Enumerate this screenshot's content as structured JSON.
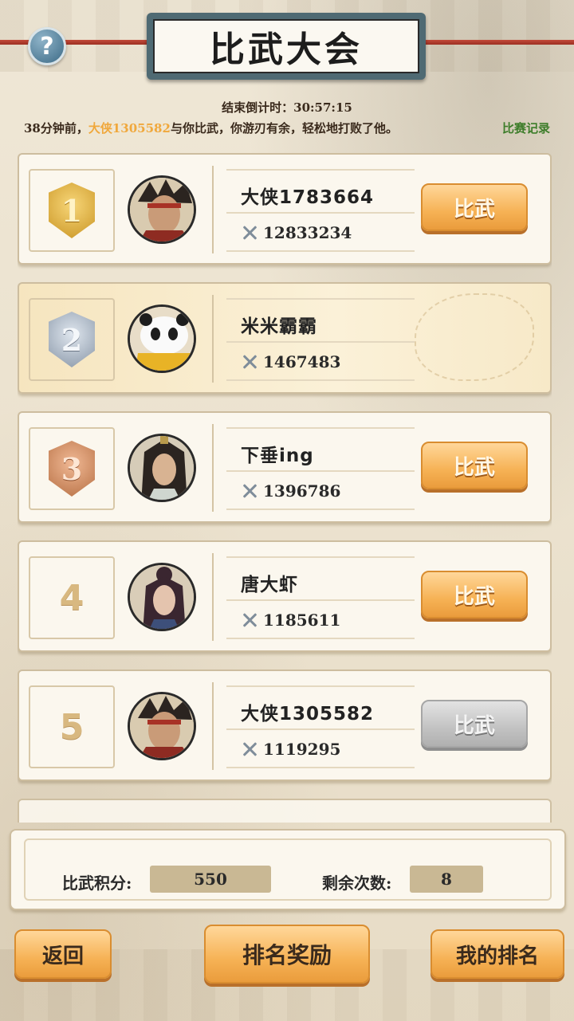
{
  "header": {
    "title": "比武大会",
    "help_glyph": "?",
    "countdown": "结束倒计时：30:57:15",
    "news_prefix": "38分钟前，",
    "news_name": "大侠1305582",
    "news_suffix": "与你比武，你游刃有余，轻松地打败了他。",
    "record_link": "比赛记录"
  },
  "players": [
    {
      "rank": "1",
      "badge": "gold",
      "name": "大侠1783664",
      "power": "12833234",
      "button": "比武",
      "button_state": "active",
      "avatar": "warrior-red-headband"
    },
    {
      "rank": "2",
      "badge": "silver",
      "name": "米米霸霸",
      "power": "1467483",
      "button": "",
      "button_state": "self",
      "avatar": "panda"
    },
    {
      "rank": "3",
      "badge": "bronze",
      "name": "下垂ing",
      "power": "1396786",
      "button": "比武",
      "button_state": "active",
      "avatar": "swordsman-long-hair"
    },
    {
      "rank": "4",
      "badge": "plain",
      "name": "唐大虾",
      "power": "1185611",
      "button": "比武",
      "button_state": "active",
      "avatar": "woman-hair-bun"
    },
    {
      "rank": "5",
      "badge": "plain",
      "name": "大侠1305582",
      "power": "1119295",
      "button": "比武",
      "button_state": "disabled",
      "avatar": "warrior-red-headband"
    }
  ],
  "stats": {
    "score_label": "比武积分:",
    "score_value": "550",
    "remaining_label": "剩余次数:",
    "remaining_value": "8"
  },
  "footer": {
    "back": "返回",
    "rank_reward": "排名奖励",
    "my_rank": "我的排名"
  },
  "colors": {
    "highlight_name": "#f0a83c",
    "record_link": "#3d7d2a",
    "button_orange": "#f6b255",
    "button_disabled": "#c2c2c2",
    "plaque": "#4f6a73"
  }
}
